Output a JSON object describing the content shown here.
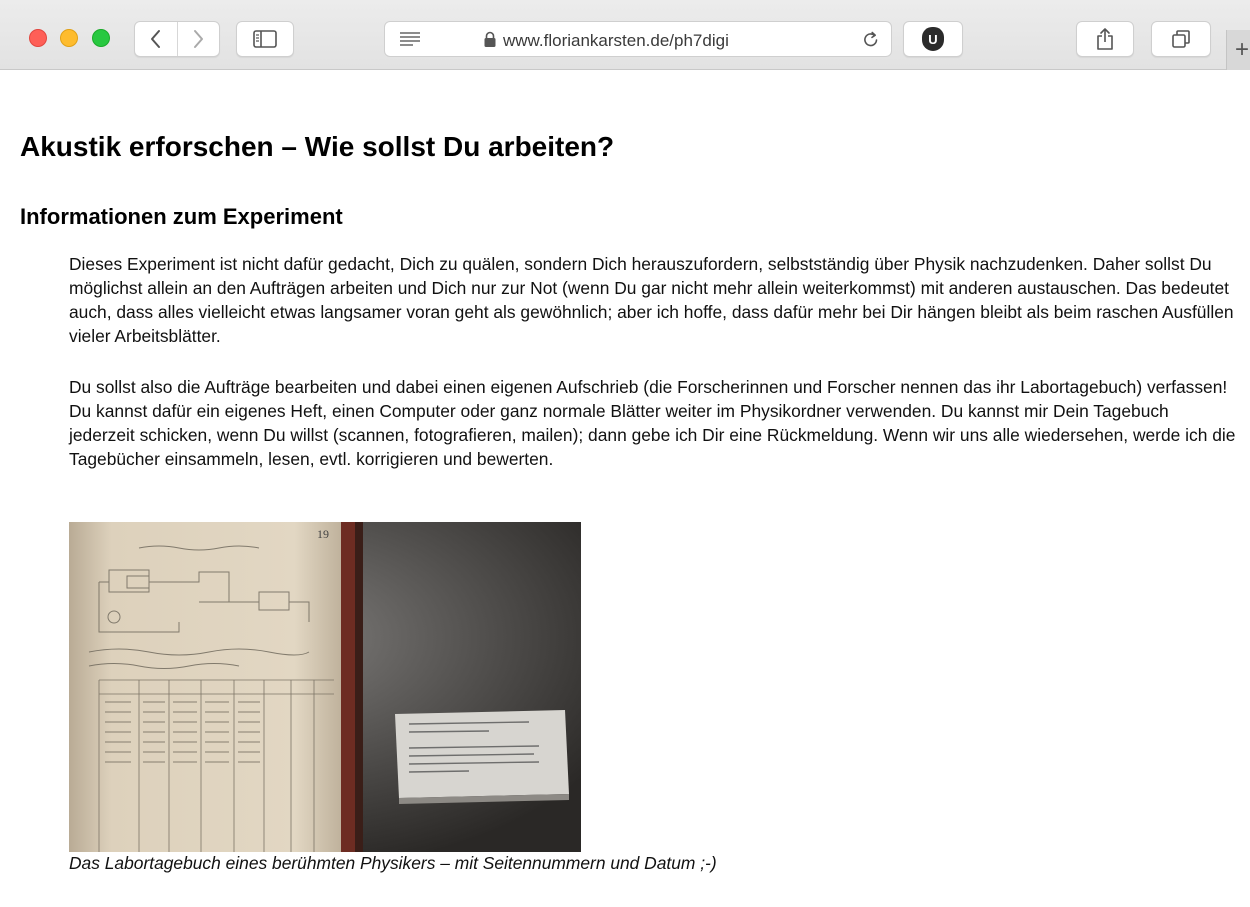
{
  "browser": {
    "url": "www.floriankarsten.de/ph7digi",
    "extension_badge": "U",
    "new_tab": "+"
  },
  "page": {
    "title": "Akustik erforschen – Wie sollst Du arbeiten?",
    "subtitle": "Informationen zum Experiment",
    "paragraphs": [
      "Dieses Experiment ist nicht dafür gedacht, Dich zu quälen, sondern Dich herauszufordern, selbstständig über Physik nachzudenken. Daher sollst Du möglichst allein an den Aufträgen arbeiten und Dich nur zur Not (wenn Du gar nicht mehr allein weiterkommst) mit anderen austauschen. Das bedeutet auch, dass alles vielleicht etwas langsamer voran geht als gewöhnlich; aber ich hoffe, dass dafür mehr bei Dir hängen bleibt als beim raschen Ausfüllen vieler Arbeitsblätter.",
      "Du sollst also die Aufträge bearbeiten und dabei einen eigenen Aufschrieb (die Forscherinnen und Forscher nennen das ihr Labortagebuch) verfassen! Du kannst dafür ein eigenes Heft, einen Computer oder ganz normale Blätter weiter im Physikordner verwenden. Du kannst mir Dein Tagebuch jederzeit schicken, wenn Du willst (scannen, fotografieren, mailen); dann gebe ich Dir eine Rückmeldung. Wenn wir uns alle wiedersehen, werde ich die Tagebücher einsammeln, lesen, evtl. korrigieren und bewerten."
    ],
    "figure": {
      "page_number": "19",
      "caption": "Das Labortagebuch eines berühmten Physikers – mit Seitennummern und Datum ;-)"
    }
  }
}
